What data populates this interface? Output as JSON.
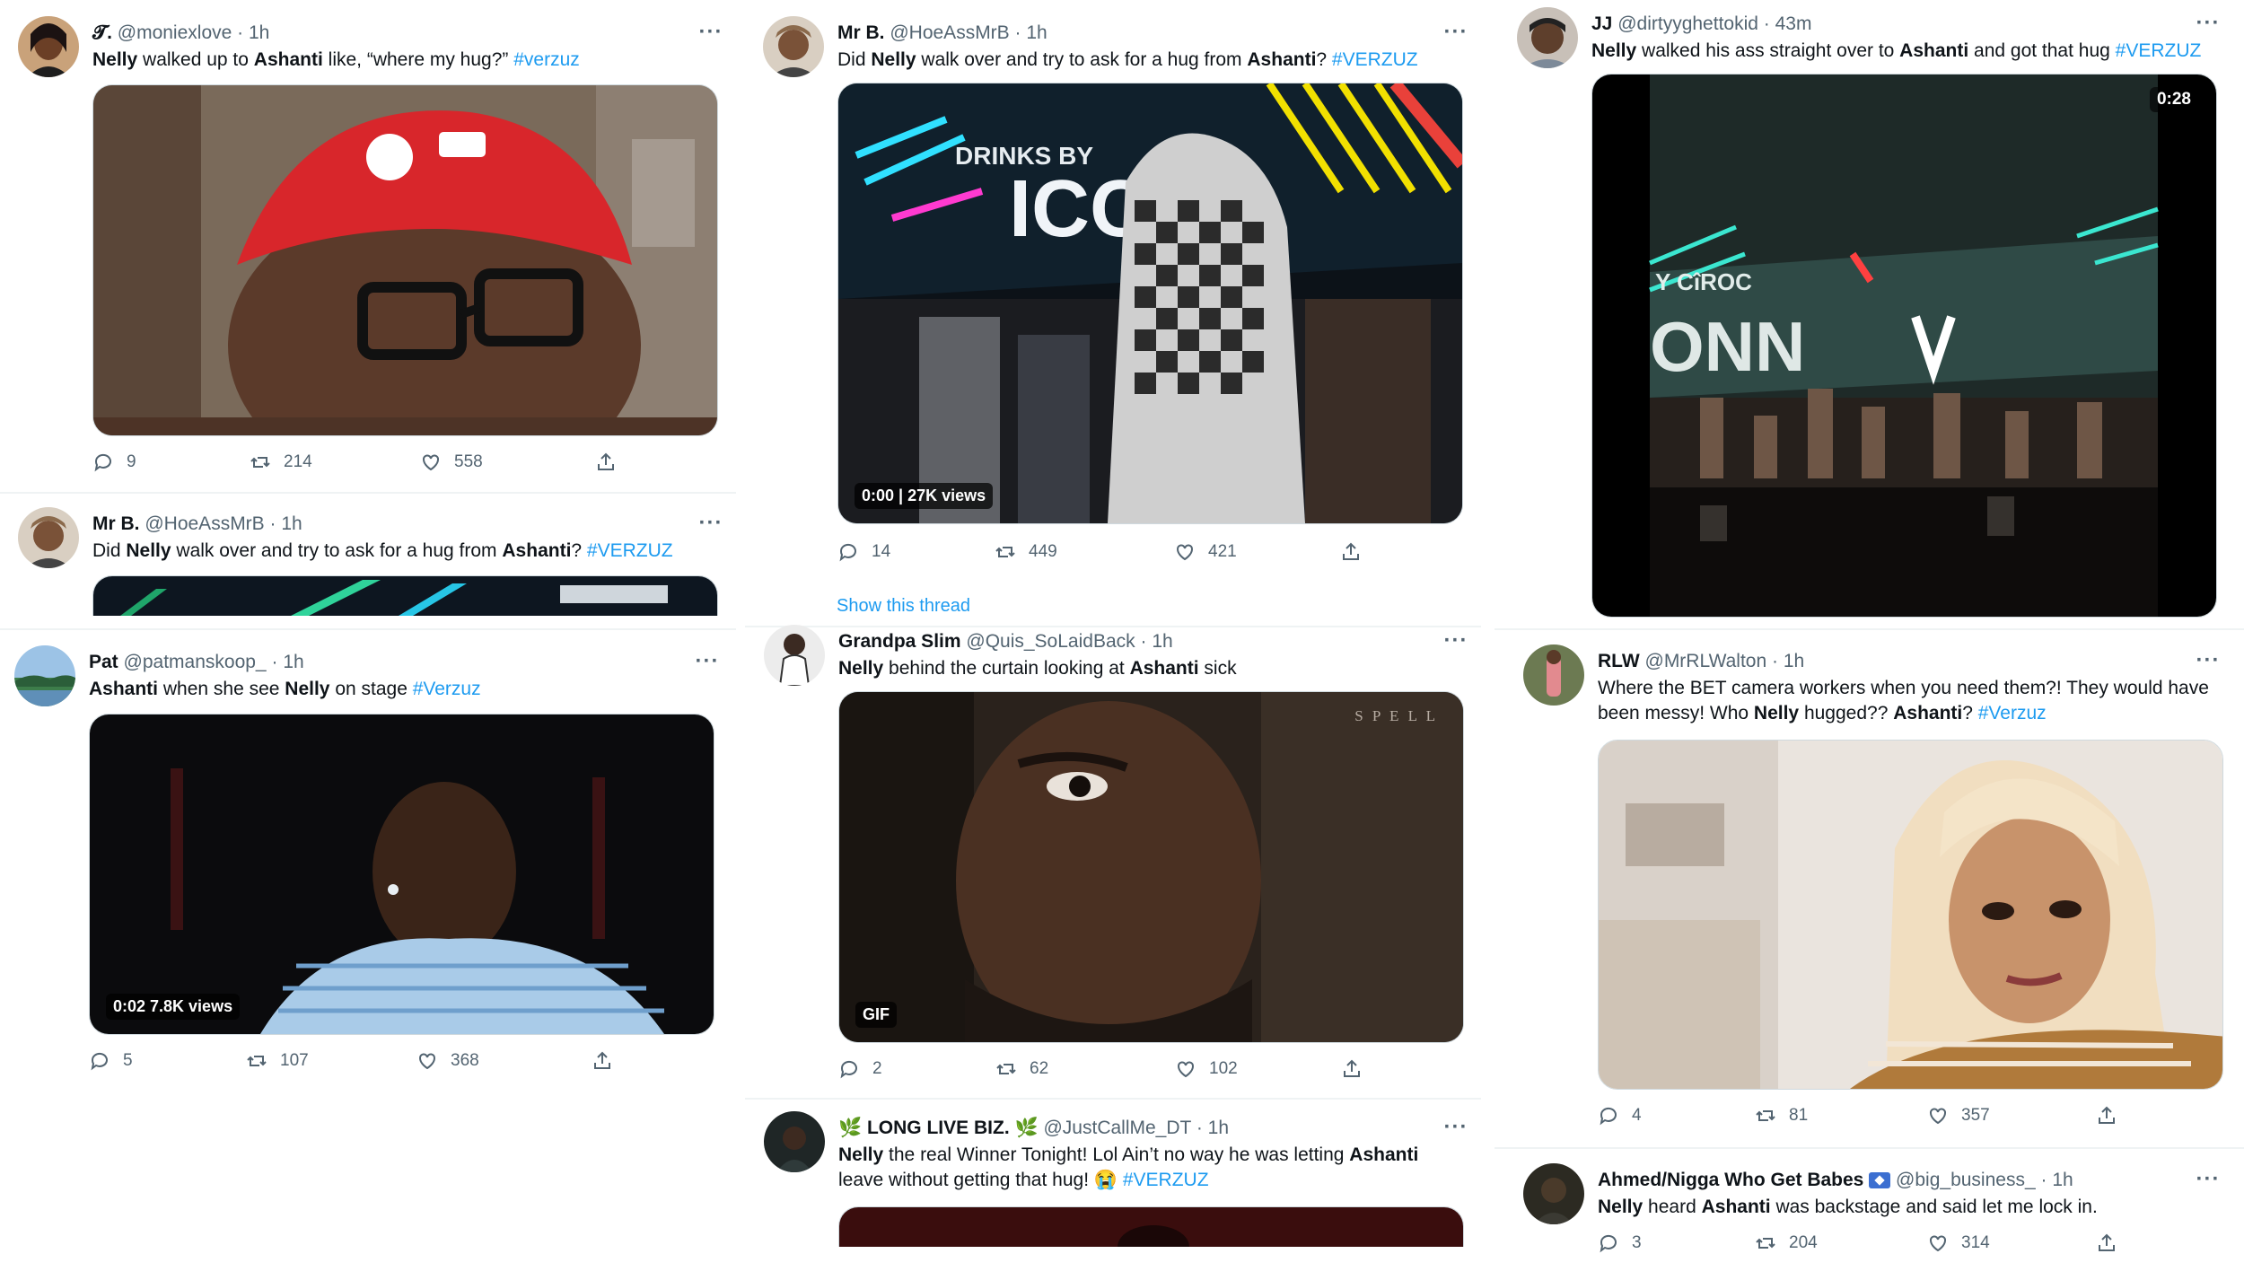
{
  "tweets": [
    {
      "name": "𝓣.",
      "handle": "@moniexlove",
      "time": "1h",
      "text_parts": [
        {
          "t": "Nelly",
          "b": 1
        },
        {
          "t": " walked up to "
        },
        {
          "t": "Ashanti",
          "b": 1
        },
        {
          "t": " like, “where my hug?” "
        },
        {
          "t": "#verzuz",
          "tag": 1
        }
      ],
      "replies": "9",
      "retweets": "214",
      "likes": "558",
      "media_icon": "man-red-cap-glasses-image"
    },
    {
      "name": "Mr B.",
      "handle": "@HoeAssMrB",
      "time": "1h",
      "text_parts": [
        {
          "t": "Did "
        },
        {
          "t": "Nelly",
          "b": 1
        },
        {
          "t": " walk over and try to ask for a hug from "
        },
        {
          "t": "Ashanti",
          "b": 1
        },
        {
          "t": "? "
        },
        {
          "t": "#VERZUZ",
          "tag": 1
        }
      ],
      "media_icon": "stage-lights-image"
    },
    {
      "name": "Pat",
      "handle": "@patmanskoop_",
      "time": "1h",
      "text_parts": [
        {
          "t": "Ashanti",
          "b": 1
        },
        {
          "t": " when she see "
        },
        {
          "t": "Nelly",
          "b": 1
        },
        {
          "t": " on stage "
        },
        {
          "t": "#Verzuz",
          "tag": 1
        }
      ],
      "badge": "0:02  7.8K views",
      "replies": "5",
      "retweets": "107",
      "likes": "368",
      "media_icon": "man-striped-shirt-video"
    },
    {
      "name": "Mr B.",
      "handle": "@HoeAssMrB",
      "time": "1h",
      "text_parts": [
        {
          "t": "Did "
        },
        {
          "t": "Nelly",
          "b": 1
        },
        {
          "t": " walk over and try to ask for a hug from "
        },
        {
          "t": "Ashanti",
          "b": 1
        },
        {
          "t": "? "
        },
        {
          "t": "#VERZUZ",
          "tag": 1
        }
      ],
      "badge": "0:00 | 27K views",
      "replies": "14",
      "retweets": "449",
      "likes": "421",
      "media_icon": "checkered-hoodie-stage-video"
    },
    {
      "name": "Grandpa Slim",
      "handle": "@Quis_SoLaidBack",
      "time": "1h",
      "text_parts": [
        {
          "t": "Nelly",
          "b": 1
        },
        {
          "t": " behind the curtain looking at "
        },
        {
          "t": "Ashanti",
          "b": 1
        },
        {
          "t": " sick"
        }
      ],
      "badge": "GIF",
      "watermark": "S P E L L",
      "replies": "2",
      "retweets": "62",
      "likes": "102",
      "media_icon": "man-peeking-gif"
    },
    {
      "name": "🌿 LONG LIVE BIZ. 🌿",
      "handle": "@JustCallMe_DT",
      "time": "1h",
      "text_parts": [
        {
          "t": "Nelly",
          "b": 1
        },
        {
          "t": " the real Winner Tonight! Lol Ain’t no way he was letting "
        },
        {
          "t": "Ashanti",
          "b": 1
        },
        {
          "t": " leave without getting that hug! 😭 "
        },
        {
          "t": "#VERZUZ",
          "tag": 1
        }
      ],
      "media_icon": "dark-red-image"
    },
    {
      "name": "JJ",
      "handle": "@dirtyyghettokid",
      "time": "43m",
      "text_parts": [
        {
          "t": "Nelly",
          "b": 1
        },
        {
          "t": " walked his ass straight over to "
        },
        {
          "t": "Ashanti",
          "b": 1
        },
        {
          "t": " and got that hug "
        },
        {
          "t": "#VERZUZ",
          "tag": 1
        }
      ],
      "badge": "0:28",
      "media_icon": "concert-crowd-video"
    },
    {
      "name": "RLW",
      "handle": "@MrRLWalton",
      "time": "1h",
      "text_parts": [
        {
          "t": "Where the BET camera workers when you need them?! They would have been messy! Who "
        },
        {
          "t": "Nelly",
          "b": 1
        },
        {
          "t": " hugged?? "
        },
        {
          "t": "Ashanti",
          "b": 1
        },
        {
          "t": "? "
        },
        {
          "t": "#Verzuz",
          "tag": 1
        }
      ],
      "replies": "4",
      "retweets": "81",
      "likes": "357",
      "media_icon": "blonde-woman-image"
    },
    {
      "name": "Ahmed/Nigga Who Get Babes",
      "handle": "@big_business_",
      "time": "1h",
      "text_parts": [
        {
          "t": "Nelly",
          "b": 1
        },
        {
          "t": " heard "
        },
        {
          "t": "Ashanti",
          "b": 1
        },
        {
          "t": " was backstage and said let me lock in."
        }
      ],
      "replies": "3",
      "retweets": "204",
      "likes": "314"
    }
  ],
  "show_thread": "Show this thread",
  "colors": {
    "accent": "#1d9bf0",
    "text": "#0f1419",
    "muted": "#536471"
  }
}
